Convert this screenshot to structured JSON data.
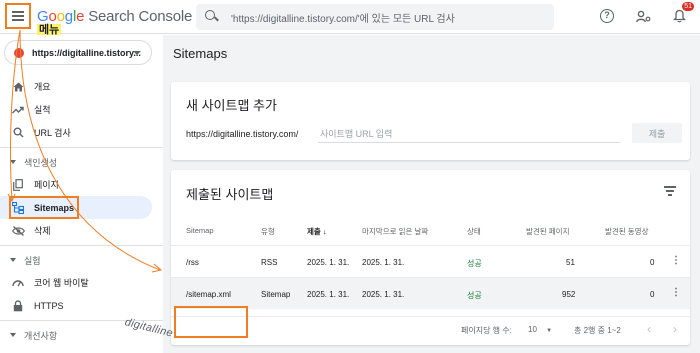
{
  "topbar": {
    "logo_google": "Google",
    "logo_product": "Search Console",
    "menu_tag": "메뉴",
    "search_placeholder": "'https://digitalline.tistory.com/'에 있는 모든 URL 검사",
    "notification_count": "51"
  },
  "sidebar": {
    "property": "https://digitalline.tistory...",
    "items_top": [
      {
        "label": "개요",
        "icon": "home-icon"
      },
      {
        "label": "실적",
        "icon": "trending-icon"
      },
      {
        "label": "URL 검사",
        "icon": "search-icon"
      }
    ],
    "section_index": "색인생성",
    "items_index": [
      {
        "label": "페이지",
        "icon": "pages-icon"
      },
      {
        "label": "Sitemaps",
        "icon": "sitemap-icon"
      },
      {
        "label": "삭제",
        "icon": "eye-off-icon"
      }
    ],
    "section_experience": "실험",
    "items_experience": [
      {
        "label": "코어 웹 바이탈",
        "icon": "gauge-icon"
      },
      {
        "label": "HTTPS",
        "icon": "lock-icon"
      }
    ],
    "section_enhancements": "개선사항"
  },
  "main": {
    "page_title": "Sitemaps",
    "add_card": {
      "title": "새 사이트맵 추가",
      "url_prefix": "https://digitalline.tistory.com/",
      "input_placeholder": "사이트맵 URL 입력",
      "submit_label": "제출"
    },
    "submitted_card": {
      "title": "제출된 사이트맵",
      "headers": {
        "sitemap": "Sitemap",
        "type": "유형",
        "submitted": "제출",
        "last_read": "마지막으로 읽은 날짜",
        "status": "상태",
        "pages": "발견된 페이지",
        "videos": "발견된 동영상"
      },
      "rows": [
        {
          "sitemap": "/rss",
          "type": "RSS",
          "submitted": "2025. 1. 31.",
          "last_read": "2025. 1. 31.",
          "status": "성공",
          "pages": "51",
          "videos": "0"
        },
        {
          "sitemap": "/sitemap.xml",
          "type": "Sitemap",
          "submitted": "2025. 1. 31.",
          "last_read": "2025. 1. 31.",
          "status": "성공",
          "pages": "952",
          "videos": "0"
        }
      ],
      "pager": {
        "rows_per_page_label": "페이지당 행 수:",
        "rows_per_page": "10",
        "range": "총 2행 중 1~2"
      }
    }
  },
  "watermark": "digitalline",
  "colors": {
    "highlight": "#f07d22",
    "success": "#188038",
    "badge": "#d93025",
    "active_nav": "#e8f0fe"
  }
}
